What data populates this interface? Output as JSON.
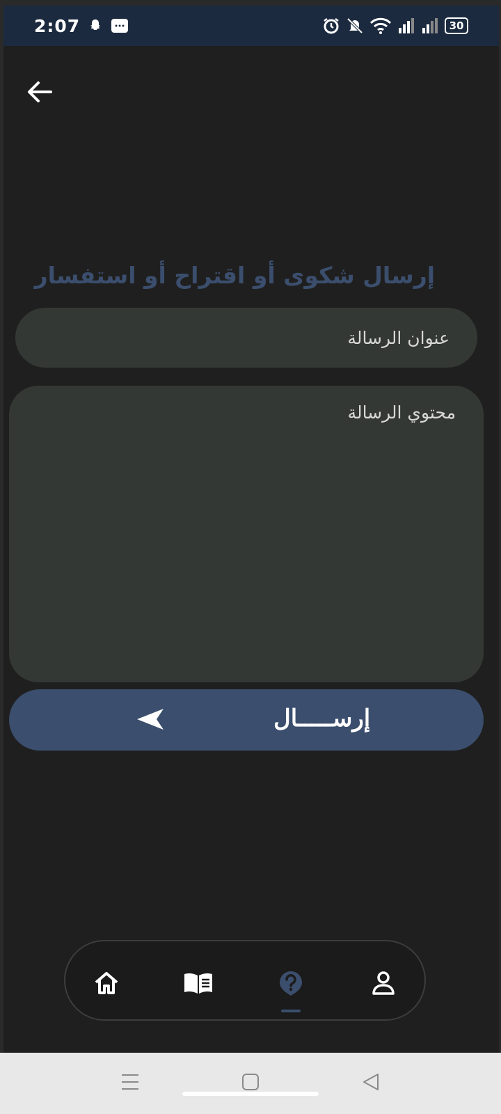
{
  "status_bar": {
    "time": "2:07",
    "battery": "30"
  },
  "page": {
    "title": "إرسال شكوى أو اقتراح أو استفسار"
  },
  "form": {
    "subject_placeholder": "عنوان الرسالة",
    "content_placeholder": "محتوي الرسالة",
    "send_label": "إرســـــال"
  },
  "bottom_nav": {
    "items": [
      {
        "name": "home",
        "icon": "home-icon"
      },
      {
        "name": "library",
        "icon": "book-icon"
      },
      {
        "name": "support",
        "icon": "help-icon",
        "active": true
      },
      {
        "name": "profile",
        "icon": "user-icon"
      }
    ]
  },
  "colors": {
    "accent": "#3b4e6d",
    "field_background": "#343834",
    "screen_background": "#1f1f1f"
  }
}
